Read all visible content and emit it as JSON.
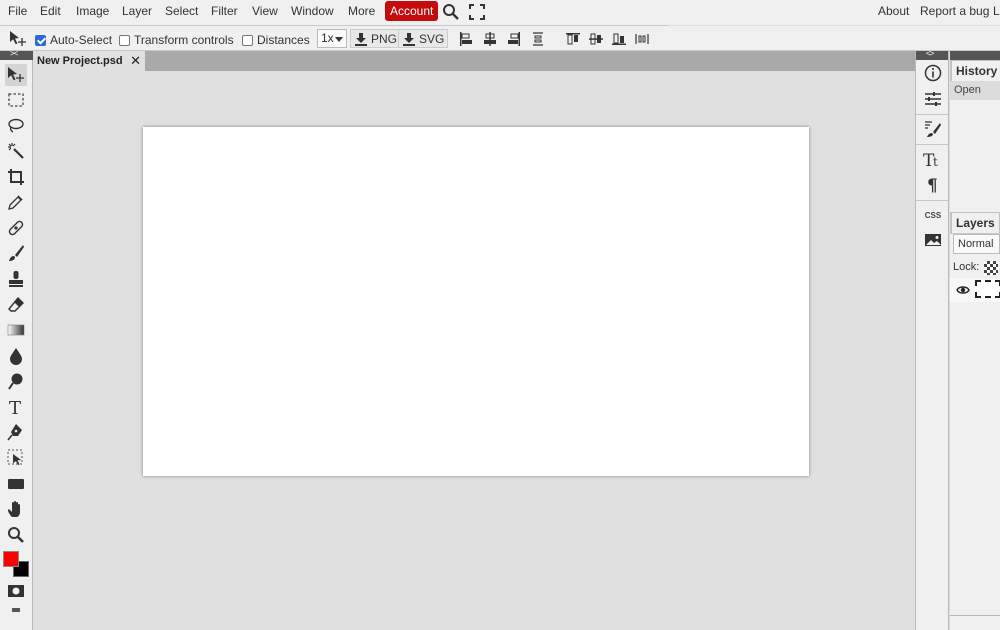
{
  "menu": {
    "file": "File",
    "edit": "Edit",
    "image": "Image",
    "layer": "Layer",
    "select": "Select",
    "filter": "Filter",
    "view": "View",
    "window": "Window",
    "more": "More",
    "account": "Account",
    "about": "About",
    "report_bug": "Report a bug",
    "lang": "L"
  },
  "options": {
    "auto_select_label": "Auto-Select",
    "auto_select_checked": true,
    "transform_label": "Transform controls",
    "transform_checked": false,
    "distances_label": "Distances",
    "distances_checked": false,
    "scale_value": "1x",
    "png_label": "PNG",
    "svg_label": "SVG"
  },
  "document": {
    "tab_title": "New Project.psd",
    "close_glyph": "✕"
  },
  "right_strip": {
    "css_label": "CSS"
  },
  "panels": {
    "history_tab": "History",
    "history_items": [
      "Open"
    ],
    "layers_tab": "Layers",
    "blend_mode": "Normal",
    "lock_label": "Lock:"
  },
  "colors": {
    "accent": "#c40c0c",
    "foreground": "#ff0000",
    "background": "#000000",
    "canvas": "#ffffff",
    "workspace": "#e0e0e0"
  }
}
